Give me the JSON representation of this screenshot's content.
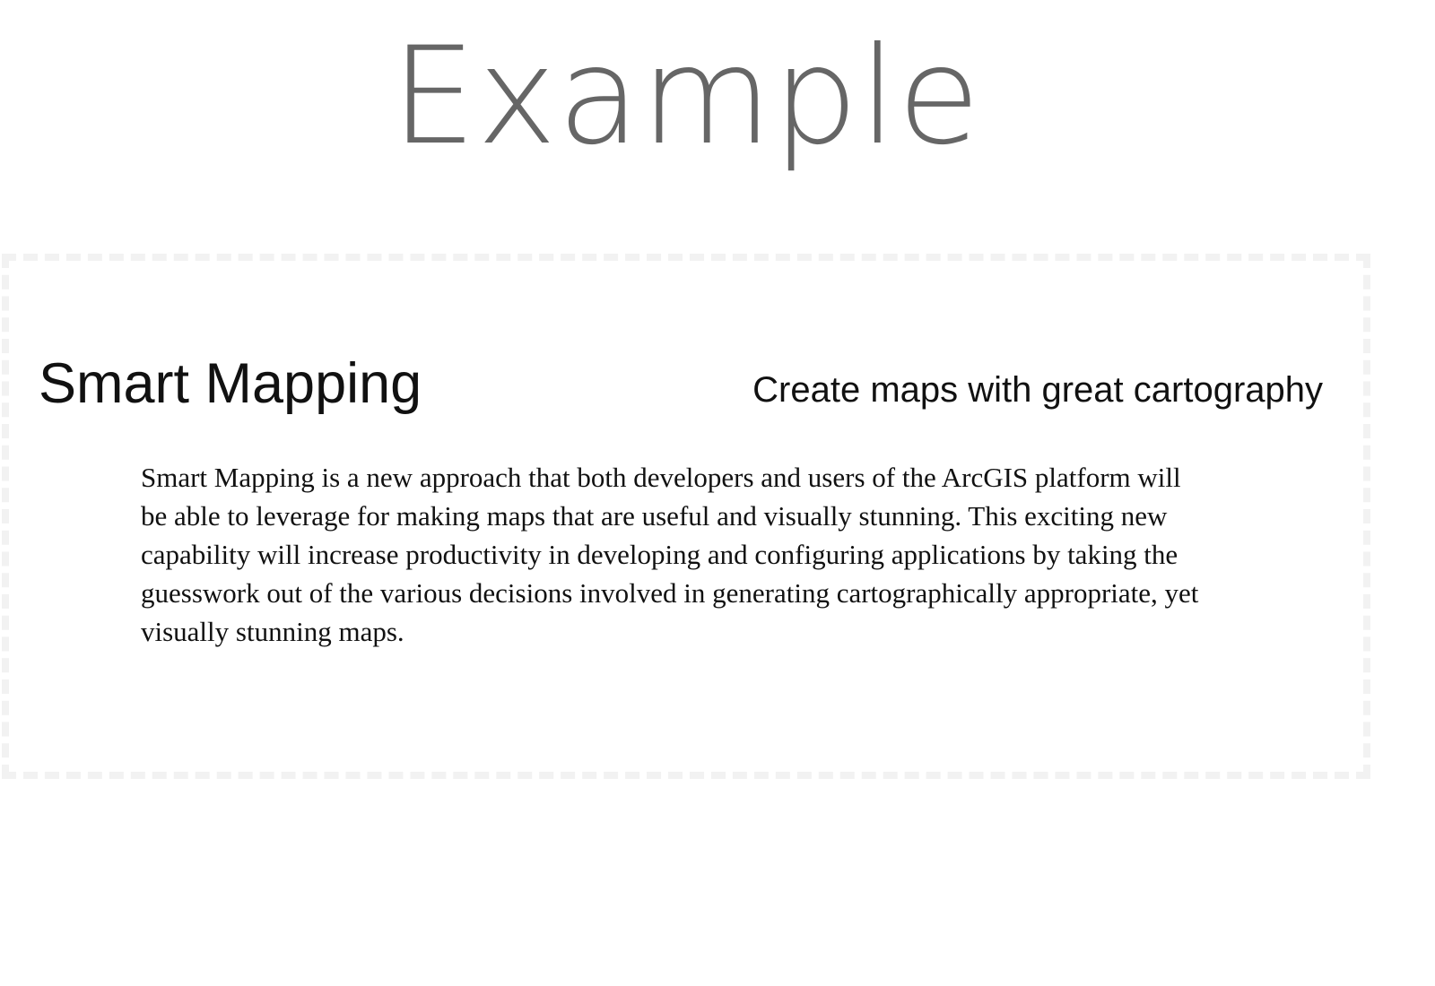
{
  "page": {
    "title": "Example"
  },
  "card": {
    "title": "Smart Mapping",
    "subtitle": "Create maps with great cartography",
    "body": "Smart Mapping is a new approach that both developers and users of the ArcGIS platform will be able to leverage for making maps that are useful and visually stunning. This exciting new capability will increase productivity in developing and configuring applications by taking the guesswork out of the various decisions involved in generating cartographically appropriate, yet visually stunning maps."
  },
  "colors": {
    "title_text": "#666666",
    "body_text": "#111111",
    "card_border": "#f2f2f2",
    "background": "#ffffff"
  }
}
